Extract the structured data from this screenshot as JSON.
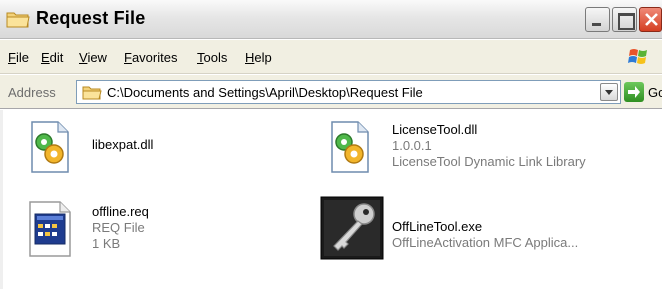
{
  "window": {
    "title": "Request File",
    "title_icon": "folder-icon",
    "buttons": {
      "minimize": "minimize-icon",
      "maximize": "maximize-icon",
      "close": "close-icon"
    }
  },
  "menu": {
    "items": [
      "File",
      "Edit",
      "View",
      "Favorites",
      "Tools",
      "Help"
    ]
  },
  "address": {
    "label": "Address",
    "path": "C:\\Documents and Settings\\April\\Desktop\\Request File",
    "go_label": "Go"
  },
  "files": [
    {
      "name": "libexpat.dll",
      "lines": [],
      "icon": "dll-gear-icon"
    },
    {
      "name": "LicenseTool.dll",
      "lines": [
        "1.0.0.1",
        "LicenseTool Dynamic Link Library"
      ],
      "icon": "dll-gear-icon"
    },
    {
      "name": "offline.req",
      "lines": [
        "REQ File",
        "1 KB"
      ],
      "icon": "req-file-icon"
    },
    {
      "name": "OffLineTool.exe",
      "lines": [
        "OffLineActivation MFC Applica..."
      ],
      "icon": "key-icon"
    }
  ],
  "colors": {
    "accent_close": "#d43e22",
    "go": "#2f8f22",
    "menu_bg": "#f1efe2"
  }
}
